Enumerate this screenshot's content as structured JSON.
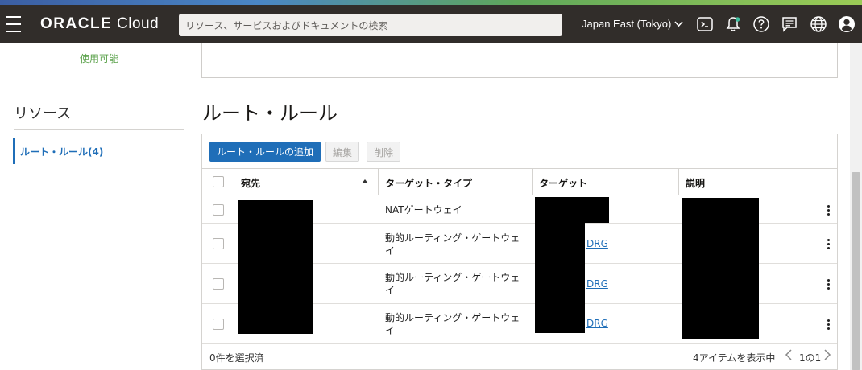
{
  "header": {
    "logo_brand": "ORACLE",
    "logo_product": "Cloud",
    "search_placeholder": "リソース、サービスおよびドキュメントの検索",
    "region": "Japan East (Tokyo)",
    "icons": [
      "hamburger-menu-icon",
      "cloud-shell-icon",
      "bell-icon",
      "help-icon",
      "chat-icon",
      "globe-icon",
      "profile-icon"
    ]
  },
  "status": {
    "available": "使用可能"
  },
  "sidebar": {
    "title": "リソース",
    "items": [
      {
        "label": "ルート・ルール(4)"
      }
    ]
  },
  "main": {
    "title": "ルート・ルール",
    "buttons": {
      "add": "ルート・ルールの追加",
      "edit": "編集",
      "delete": "削除"
    },
    "table": {
      "columns": [
        "宛先",
        "ターゲット・タイプ",
        "ターゲット",
        "説明"
      ],
      "rows": [
        {
          "target_type": "NATゲートウェイ",
          "target": ""
        },
        {
          "target_type": "動的ルーティング・ゲートウェイ",
          "target": "DRG"
        },
        {
          "target_type": "動的ルーティング・ゲートウェイ",
          "target": "DRG"
        },
        {
          "target_type": "動的ルーティング・ゲートウェイ",
          "target": "DRG"
        }
      ]
    },
    "footer": {
      "selected": "0件を選択済",
      "items_shown": "4アイテムを表示中",
      "page": "1の1"
    }
  },
  "colors": {
    "accent": "#1f6eb8",
    "header_bg": "#312d2a",
    "available_green": "#5aa14a"
  }
}
